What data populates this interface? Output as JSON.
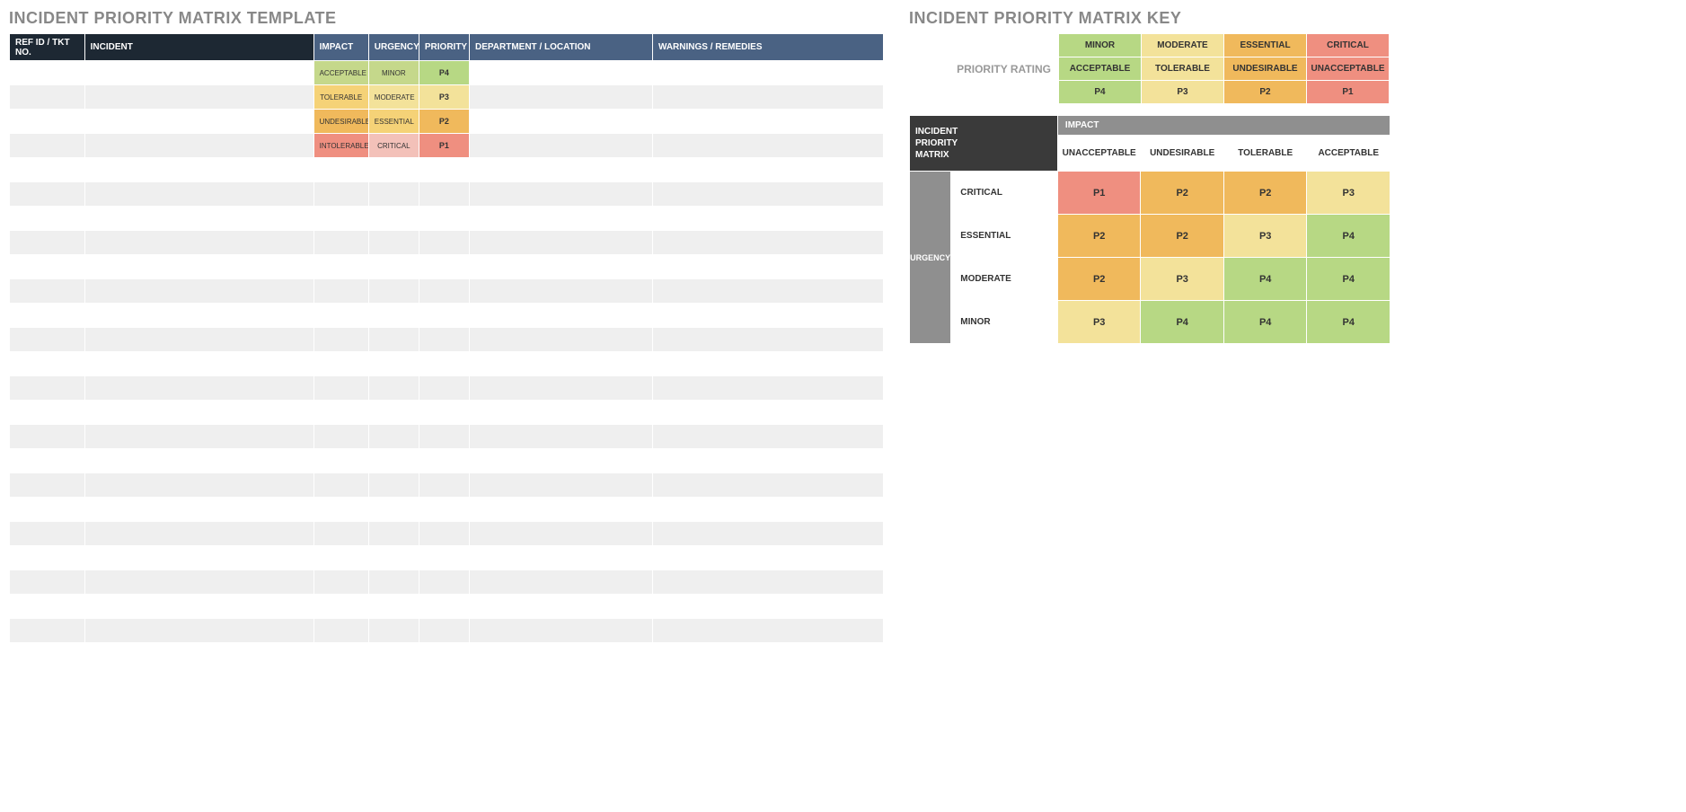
{
  "left": {
    "title": "INCIDENT PRIORITY MATRIX TEMPLATE",
    "headers": {
      "ref": "REF ID / TKT NO.",
      "incident": "INCIDENT",
      "impact": "IMPACT",
      "urgency": "URGENCY",
      "priority": "PRIORITY",
      "department": "DEPARTMENT / LOCATION",
      "warnings": "WARNINGS / REMEDIES"
    },
    "rows": [
      {
        "impact": "ACCEPTABLE",
        "urgency": "MINOR",
        "priority": "P4",
        "impClass": "c-green2",
        "urgClass": "c-green2",
        "prClass": "c-green"
      },
      {
        "impact": "TOLERABLE",
        "urgency": "MODERATE",
        "priority": "P3",
        "impClass": "c-yellow",
        "urgClass": "c-ltyellow",
        "prClass": "c-ltyellow"
      },
      {
        "impact": "UNDESIRABLE",
        "urgency": "ESSENTIAL",
        "priority": "P2",
        "impClass": "c-orange",
        "urgClass": "c-yellow",
        "prClass": "c-orange"
      },
      {
        "impact": "INTOLERABLE",
        "urgency": "CRITICAL",
        "priority": "P1",
        "impClass": "c-red",
        "urgClass": "c-redlight",
        "prClass": "c-red"
      }
    ],
    "totalRows": 24
  },
  "right": {
    "title": "INCIDENT PRIORITY MATRIX KEY",
    "ratingLabel": "PRIORITY RATING",
    "rating": [
      {
        "head": "MINOR",
        "impact": "ACCEPTABLE",
        "p": "P4",
        "cls": "c-green"
      },
      {
        "head": "MODERATE",
        "impact": "TOLERABLE",
        "p": "P3",
        "cls": "c-ltyellow"
      },
      {
        "head": "ESSENTIAL",
        "impact": "UNDESIRABLE",
        "p": "P2",
        "cls": "c-orange"
      },
      {
        "head": "CRITICAL",
        "impact": "UNACCEPTABLE",
        "p": "P1",
        "cls": "c-red"
      }
    ],
    "matrix": {
      "corner": "INCIDENT PRIORITY MATRIX",
      "impactHdr": "IMPACT",
      "urgencyHdr": "URGENCY",
      "cols": [
        "UNACCEPTABLE",
        "UNDESIRABLE",
        "TOLERABLE",
        "ACCEPTABLE"
      ],
      "rows": [
        {
          "urg": "CRITICAL",
          "cells": [
            {
              "v": "P1",
              "cls": "c-red"
            },
            {
              "v": "P2",
              "cls": "c-orange"
            },
            {
              "v": "P2",
              "cls": "c-orange"
            },
            {
              "v": "P3",
              "cls": "c-ltyellow"
            }
          ]
        },
        {
          "urg": "ESSENTIAL",
          "cells": [
            {
              "v": "P2",
              "cls": "c-orange"
            },
            {
              "v": "P2",
              "cls": "c-orange"
            },
            {
              "v": "P3",
              "cls": "c-ltyellow"
            },
            {
              "v": "P4",
              "cls": "c-green"
            }
          ]
        },
        {
          "urg": "MODERATE",
          "cells": [
            {
              "v": "P2",
              "cls": "c-orange"
            },
            {
              "v": "P3",
              "cls": "c-ltyellow"
            },
            {
              "v": "P4",
              "cls": "c-green"
            },
            {
              "v": "P4",
              "cls": "c-green"
            }
          ]
        },
        {
          "urg": "MINOR",
          "cells": [
            {
              "v": "P3",
              "cls": "c-ltyellow"
            },
            {
              "v": "P4",
              "cls": "c-green"
            },
            {
              "v": "P4",
              "cls": "c-green"
            },
            {
              "v": "P4",
              "cls": "c-green"
            }
          ]
        }
      ]
    }
  }
}
